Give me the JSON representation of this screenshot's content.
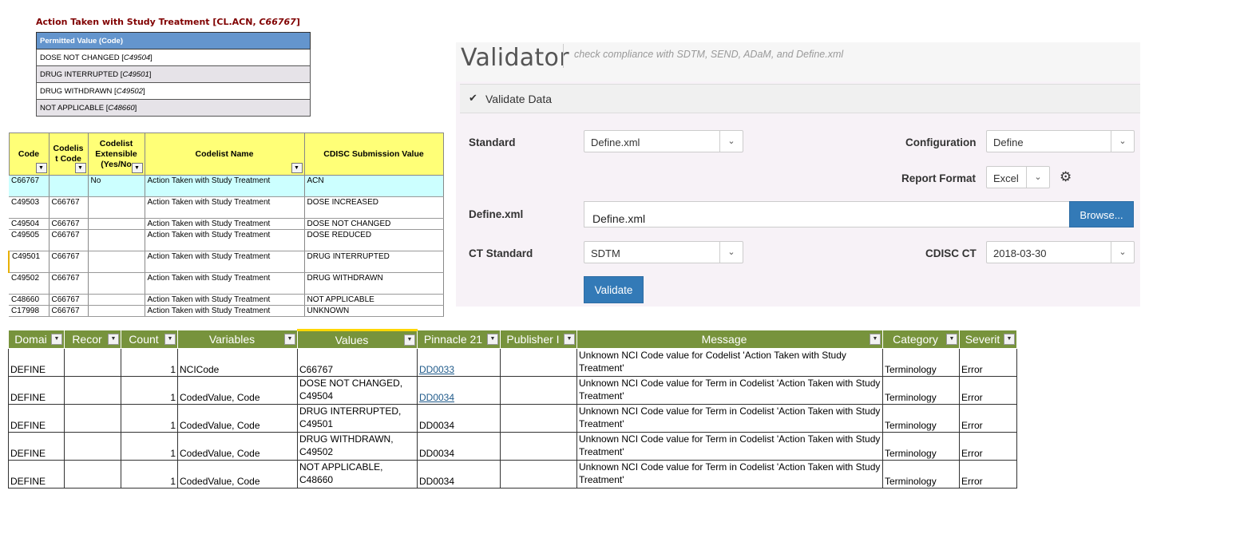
{
  "codelist_panel": {
    "title_prefix": "Action Taken with Study Treatment [CL.ACN, ",
    "title_code": "C66767",
    "title_suffix": "]",
    "header": "Permitted Value (Code)",
    "rows": [
      {
        "value": "DOSE NOT CHANGED",
        "code": "C49504"
      },
      {
        "value": "DRUG INTERRUPTED",
        "code": "C49501"
      },
      {
        "value": "DRUG WITHDRAWN",
        "code": "C49502"
      },
      {
        "value": "NOT APPLICABLE",
        "code": "C48660"
      }
    ]
  },
  "ct_sheet": {
    "columns": [
      "Code",
      "Codelis t Code",
      "Codelist Extensible (Yes/No",
      "Codelist Name",
      "CDISC Submission Value"
    ],
    "rows": [
      [
        "C66767",
        "",
        "No",
        "Action Taken with Study Treatment",
        "ACN"
      ],
      [
        "C49503",
        "C66767",
        "",
        "Action Taken with Study Treatment",
        "DOSE INCREASED"
      ],
      [
        "C49504",
        "C66767",
        "",
        "Action Taken with Study Treatment",
        "DOSE NOT CHANGED"
      ],
      [
        "C49505",
        "C66767",
        "",
        "Action Taken with Study Treatment",
        "DOSE REDUCED"
      ],
      [
        "C49501",
        "C66767",
        "",
        "Action Taken with Study Treatment",
        "DRUG INTERRUPTED"
      ],
      [
        "C49502",
        "C66767",
        "",
        "Action Taken with Study Treatment",
        "DRUG WITHDRAWN"
      ],
      [
        "C48660",
        "C66767",
        "",
        "Action Taken with Study Treatment",
        "NOT APPLICABLE"
      ],
      [
        "C17998",
        "C66767",
        "",
        "Action Taken with Study Treatment",
        "UNKNOWN"
      ]
    ]
  },
  "validator": {
    "title": "Validator",
    "subtitle": "check compliance with SDTM, SEND, ADaM, and Define.xml",
    "section_label": "Validate Data",
    "standard_label": "Standard",
    "standard_value": "Define.xml",
    "configuration_label": "Configuration",
    "configuration_value": "Define",
    "report_format_label": "Report Format",
    "report_format_value": "Excel",
    "define_label": "Define.xml",
    "define_value": "Define.xml",
    "browse_label": "Browse...",
    "ct_standard_label": "CT Standard",
    "ct_standard_value": "SDTM",
    "cdisc_ct_label": "CDISC CT",
    "cdisc_ct_value": "2018-03-30",
    "validate_label": "Validate"
  },
  "report": {
    "columns": [
      "Domai",
      "Recor",
      "Count",
      "Variables",
      "Values",
      "Pinnacle 21",
      "Publisher I",
      "Message",
      "Category",
      "Severit"
    ],
    "rows": [
      [
        "DEFINE",
        "",
        "1",
        "NCICode",
        "C66767",
        "DD0033",
        "",
        "Unknown NCI Code value for Codelist 'Action Taken with Study Treatment'",
        "Terminology",
        "Error"
      ],
      [
        "DEFINE",
        "",
        "1",
        "CodedValue, Code",
        "DOSE NOT CHANGED, C49504",
        "DD0034",
        "",
        "Unknown NCI Code value for Term in Codelist 'Action Taken with Study Treatment'",
        "Terminology",
        "Error"
      ],
      [
        "DEFINE",
        "",
        "1",
        "CodedValue, Code",
        "DRUG INTERRUPTED, C49501",
        "DD0034",
        "",
        "Unknown NCI Code value for Term in Codelist 'Action Taken with Study Treatment'",
        "Terminology",
        "Error"
      ],
      [
        "DEFINE",
        "",
        "1",
        "CodedValue, Code",
        "DRUG WITHDRAWN, C49502",
        "DD0034",
        "",
        "Unknown NCI Code value for Term in Codelist 'Action Taken with Study Treatment'",
        "Terminology",
        "Error"
      ],
      [
        "DEFINE",
        "",
        "1",
        "CodedValue, Code",
        "NOT APPLICABLE, C48660",
        "DD0034",
        "",
        "Unknown NCI Code value for Term in Codelist 'Action Taken with Study Treatment'",
        "Terminology",
        "Error"
      ]
    ]
  },
  "colors": {
    "codelist_header": "#6495cd",
    "codelist_title": "#800000",
    "sheet_header": "#ffff77",
    "highlight_row": "#ccffff",
    "report_header": "#77933c",
    "button_primary": "#337ab7"
  },
  "icons": {
    "check": "check-icon",
    "chevron": "chevron-down-icon",
    "gear": "gear-icon",
    "filter": "filter-dropdown-icon"
  }
}
